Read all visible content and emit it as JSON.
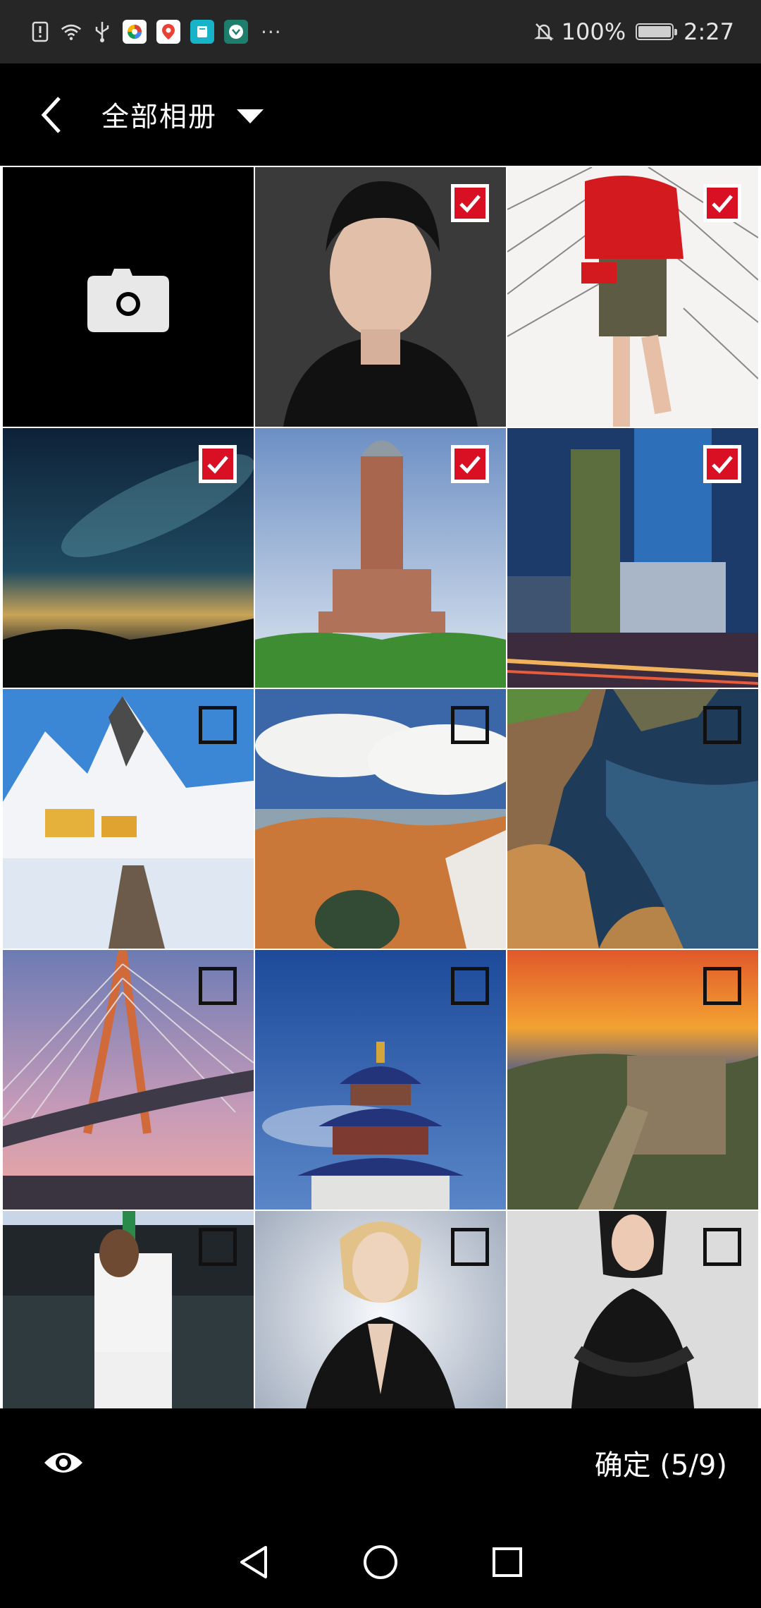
{
  "status_bar": {
    "battery_text": "100%",
    "time": "2:27",
    "more_glyph": "···",
    "icons": [
      "alert-icon",
      "wifi-icon",
      "usb-icon",
      "app-photos-icon",
      "app-maps-icon",
      "app-books-icon",
      "app-wallet-icon",
      "mute-icon",
      "battery-icon"
    ]
  },
  "toolbar": {
    "title": "全部相册"
  },
  "grid": {
    "camera_tile_icon": "camera-icon",
    "photos": [
      {
        "name": "portrait-young-man",
        "selected": true
      },
      {
        "name": "fashion-red-jacket",
        "selected": true
      },
      {
        "name": "milky-way-night",
        "selected": true
      },
      {
        "name": "bell-tower-spain",
        "selected": true
      },
      {
        "name": "city-skyscrapers",
        "selected": true
      },
      {
        "name": "snowy-mountain-village",
        "selected": false
      },
      {
        "name": "canyon-arch-clouds",
        "selected": false
      },
      {
        "name": "sea-cliffs",
        "selected": false
      },
      {
        "name": "cable-stayed-bridge",
        "selected": false
      },
      {
        "name": "temple-of-heaven",
        "selected": false
      },
      {
        "name": "great-wall-sunset",
        "selected": false
      },
      {
        "name": "basketball-player",
        "selected": false
      },
      {
        "name": "woman-black-blazer",
        "selected": false
      },
      {
        "name": "woman-black-dress",
        "selected": false
      }
    ]
  },
  "bottom_bar": {
    "preview_icon": "eye-icon",
    "confirm_label": "确定 (5/9)"
  },
  "nav_bar": {
    "icons": [
      "back-triangle-icon",
      "home-circle-icon",
      "recents-square-icon"
    ]
  },
  "colors": {
    "accent_check": "#d91024",
    "status_bar_bg": "#262626",
    "background": "#000000"
  }
}
